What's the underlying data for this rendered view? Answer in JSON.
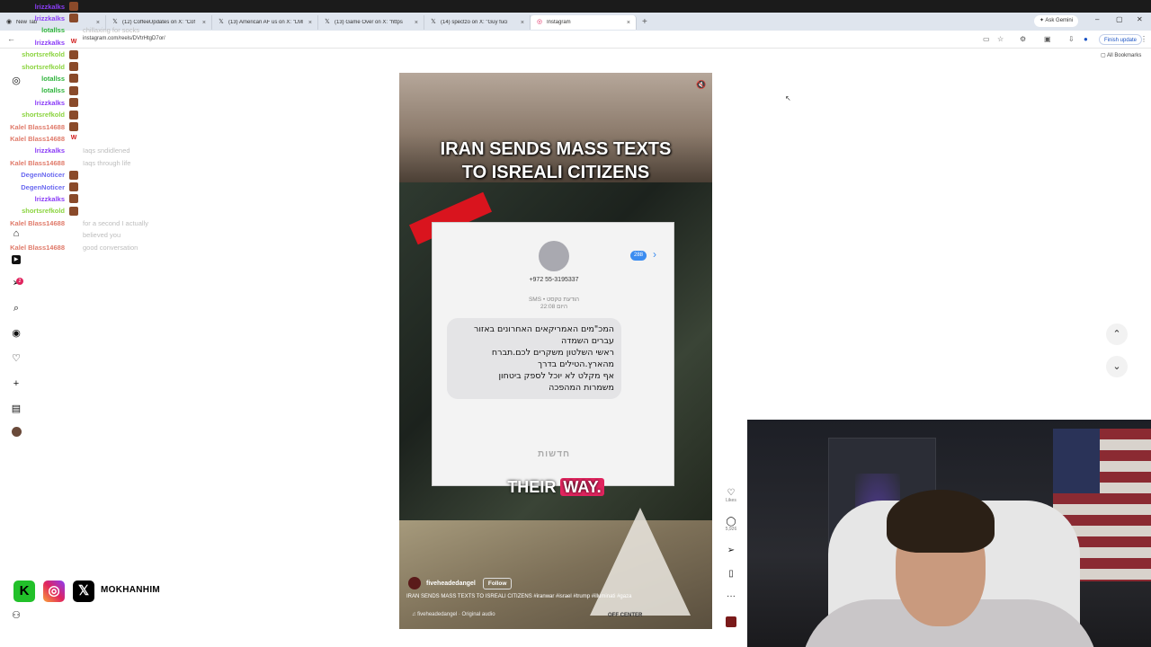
{
  "browser": {
    "tabs": [
      {
        "label": "New Tab",
        "icon": "chrome-icon",
        "active": false
      },
      {
        "label": "(12) CoffeeUpdates on X: \"Cof",
        "icon": "x-logo-icon",
        "active": false
      },
      {
        "label": "(13) American AF us on X: \"LMF",
        "icon": "x-logo-icon",
        "active": false
      },
      {
        "label": "(13) Game Over on X: \"https",
        "icon": "x-logo-icon",
        "active": false
      },
      {
        "label": "(14) spectzo on X: \"Guy fuci",
        "icon": "x-logo-icon",
        "active": false
      },
      {
        "label": "Instagram",
        "icon": "instagram-icon",
        "active": true
      }
    ],
    "ask_gemini": "Ask Gemini",
    "url": "instagram.com/reels/DVtrHtgD7or/",
    "finish_update": "Finish update",
    "all_bookmarks": "All Bookmarks"
  },
  "chat": [
    {
      "name": "lrizzkalks",
      "color": "#8b3df7",
      "emote": "",
      "message": ""
    },
    {
      "name": "lrizzkalks",
      "color": "#8b3df7",
      "emote": "",
      "message": ""
    },
    {
      "name": "lotallss",
      "color": "#2fb43c",
      "emote": "",
      "message": "chillaxing for socks"
    },
    {
      "name": "lrizzkalks",
      "color": "#8b3df7",
      "emote": "W",
      "message": ""
    },
    {
      "name": "shortsrefkold",
      "color": "#8bd43f",
      "emote": "",
      "message": ""
    },
    {
      "name": "shortsrefkold",
      "color": "#8bd43f",
      "emote": "",
      "message": ""
    },
    {
      "name": "lotallss",
      "color": "#2fb43c",
      "emote": "",
      "message": ""
    },
    {
      "name": "lotallss",
      "color": "#2fb43c",
      "emote": "",
      "message": ""
    },
    {
      "name": "lrizzkalks",
      "color": "#8b3df7",
      "emote": "",
      "message": ""
    },
    {
      "name": "shortsrefkold",
      "color": "#8bd43f",
      "emote": "",
      "message": ""
    },
    {
      "name": "Kalel Blass14688",
      "color": "#e07a6a",
      "emote": "",
      "message": ""
    },
    {
      "name": "Kalel Blass14688",
      "color": "#e07a6a",
      "emote": "W",
      "message": ""
    },
    {
      "name": "lrizzkalks",
      "color": "#8b3df7",
      "emote": "",
      "message": "Iaqs sndidlened"
    },
    {
      "name": "Kalel Blass14688",
      "color": "#e07a6a",
      "emote": "",
      "message": "Iaqs through life"
    },
    {
      "name": "DegenNoticer",
      "color": "#6b6af0",
      "emote": "",
      "message": ""
    },
    {
      "name": "DegenNoticer",
      "color": "#6b6af0",
      "emote": "",
      "message": ""
    },
    {
      "name": "lrizzkalks",
      "color": "#8b3df7",
      "emote": "",
      "message": ""
    },
    {
      "name": "shortsrefkold",
      "color": "#8bd43f",
      "emote": "",
      "message": ""
    },
    {
      "name": "Kalel Blass14688",
      "color": "#e07a6a",
      "emote": "",
      "message": "for a second I actually"
    },
    {
      "name": "",
      "color": "#e07a6a",
      "emote": "",
      "message": "believed you"
    },
    {
      "name": "Kalel Blass14688",
      "color": "#e07a6a",
      "emote": "",
      "message": "good conversation"
    }
  ],
  "reel": {
    "headline": "IRAN SENDS MASS TEXTS\nTO ISREALI CITIZENS",
    "phone_number": "+972 55-3195337",
    "badge": "288",
    "sms_meta": "SMS • הודעת טקסט\nהיום 22:08",
    "message": "המכ\"מים האמריקאים האחרונים באזור\nעברים השמדה\nראשי השלטון משקרים לכם.תברח\nמהארץ.הטילים בדרך\nאף מקלט לא יוכל לספק ביטחון\nמשמרות המהפכה",
    "watermark": "חדשות",
    "caption_a": "THEIR",
    "caption_b": "WAY.",
    "username": "fiveheadedangel",
    "follow": "Follow",
    "description": "IRAN SENDS MASS TEXTS TO ISREALI CITIZENS #iranwar #israel #trump #illuminati #gaza",
    "audio": "♫ fiveheadedangel · Original audio",
    "pyramid_text": "OFF CENTER"
  },
  "actions": {
    "likes_label": "Likes",
    "comments_count": "5,926"
  },
  "socials": {
    "handle": "MOKHANHIM"
  }
}
